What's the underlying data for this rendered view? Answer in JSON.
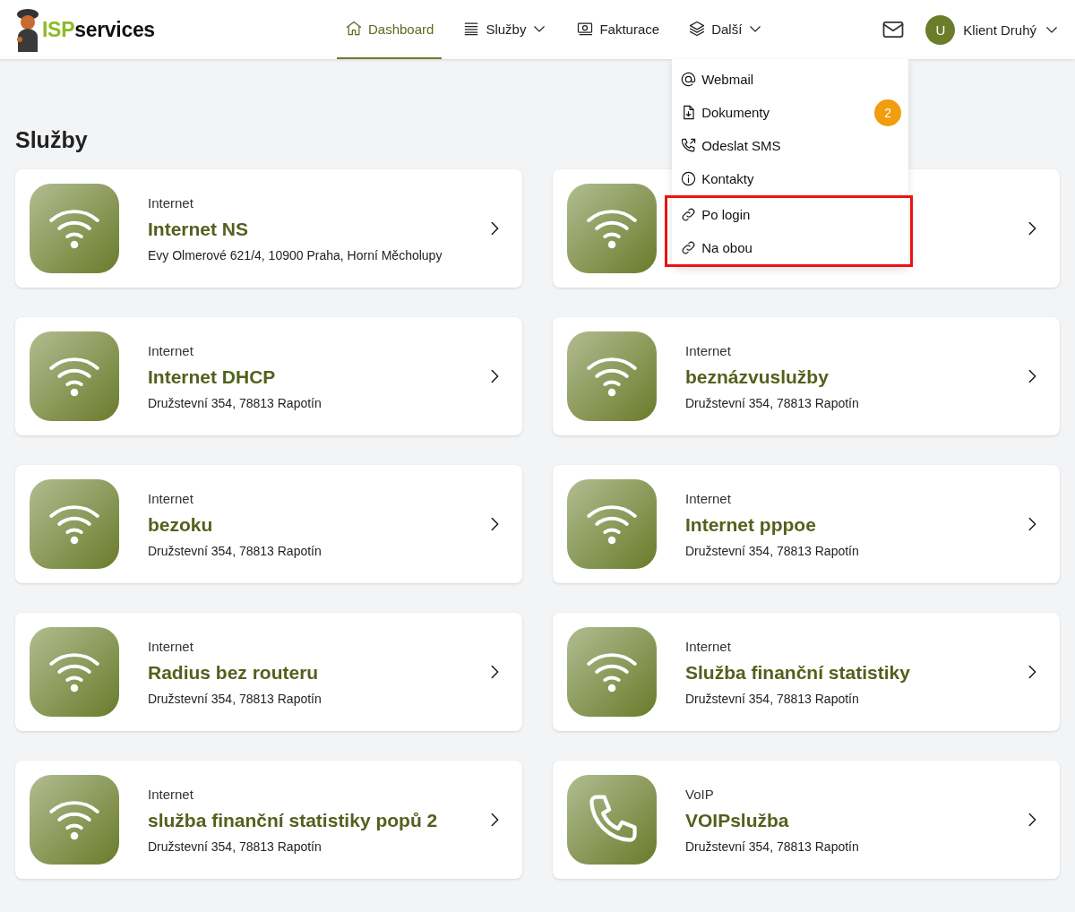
{
  "logo": {
    "text_1": "ISP",
    "text_2": "services"
  },
  "nav": [
    {
      "label": "Dashboard",
      "selected": true,
      "caret": false,
      "expanded": false
    },
    {
      "label": "Služby",
      "selected": false,
      "caret": true,
      "expanded": false
    },
    {
      "label": "Fakturace",
      "selected": false,
      "caret": false,
      "expanded": false
    },
    {
      "label": "Další",
      "selected": false,
      "caret": true,
      "expanded": true
    }
  ],
  "user": {
    "avatar": "U",
    "name": "Klient Druhý"
  },
  "dropdown": [
    {
      "label": "Webmail",
      "highlighted": false
    },
    {
      "label": "Dokumenty",
      "badge": "2",
      "highlighted": false
    },
    {
      "label": "Odeslat SMS",
      "highlighted": false
    },
    {
      "label": "Kontakty",
      "highlighted": false
    },
    {
      "label": "Po login",
      "highlighted": true
    },
    {
      "label": "Na obou",
      "highlighted": true
    }
  ],
  "page_title": "Služby",
  "services": [
    {
      "kind": "internet",
      "category": "Internet",
      "title": "Internet NS",
      "address": "Evy Olmerové 621/4, 10900 Praha, Horní Měcholupy"
    },
    {
      "kind": "internet"
    },
    {
      "kind": "internet",
      "category": "Internet",
      "title": "Internet DHCP",
      "address": "Družstevní 354, 78813 Rapotín"
    },
    {
      "kind": "internet",
      "category": "Internet",
      "title": "beznázvuslužby",
      "address": "Družstevní 354, 78813 Rapotín"
    },
    {
      "kind": "internet",
      "category": "Internet",
      "title": "bezoku",
      "address": "Družstevní 354, 78813 Rapotín"
    },
    {
      "kind": "internet",
      "category": "Internet",
      "title": "Internet pppoe",
      "address": "Družstevní 354, 78813 Rapotín"
    },
    {
      "kind": "internet",
      "category": "Internet",
      "title": "Radius bez routeru",
      "address": "Družstevní 354, 78813 Rapotín"
    },
    {
      "kind": "internet",
      "category": "Internet",
      "title": "Služba finanční statistiky",
      "address": "Družstevní 354, 78813 Rapotín"
    },
    {
      "kind": "internet",
      "category": "Internet",
      "title": "služba finanční statistiky popů 2",
      "address": "Družstevní 354, 78813 Rapotín"
    },
    {
      "kind": "voip",
      "category": "VoIP",
      "title": "VOIPslužba",
      "address": "Družstevní 354, 78813 Rapotín"
    }
  ]
}
